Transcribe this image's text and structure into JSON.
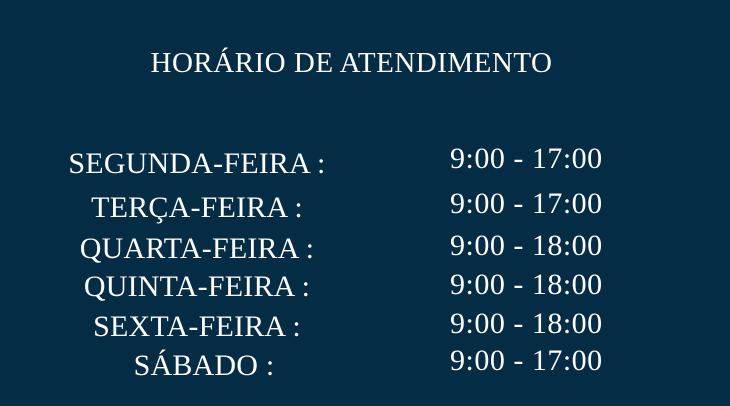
{
  "title": "HORÁRIO DE ATENDIMENTO",
  "schedule": [
    {
      "day": "SEGUNDA-FEIRA :",
      "hours": "9:00 - 17:00"
    },
    {
      "day": "TERÇA-FEIRA :",
      "hours": "9:00 - 17:00"
    },
    {
      "day": "QUARTA-FEIRA :",
      "hours": "9:00 - 18:00"
    },
    {
      "day": "QUINTA-FEIRA :",
      "hours": "9:00 - 18:00"
    },
    {
      "day": "SEXTA-FEIRA :",
      "hours": "9:00 - 18:00"
    },
    {
      "day": "SÁBADO :",
      "hours": "9:00 - 17:00"
    }
  ],
  "colors": {
    "background": "#042d45",
    "text": "#ffffff"
  }
}
